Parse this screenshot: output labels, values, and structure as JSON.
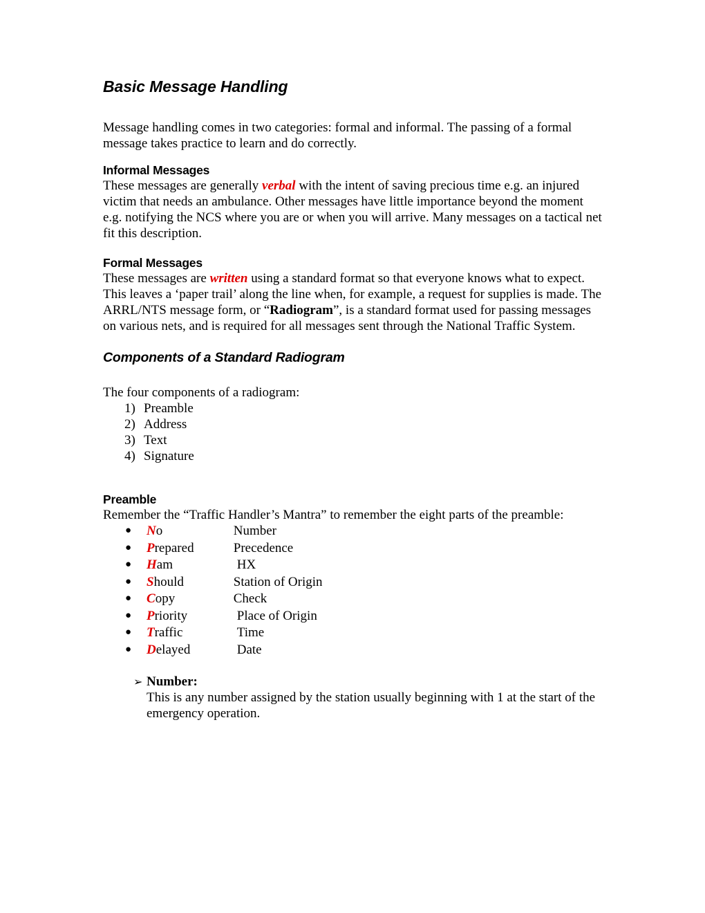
{
  "document": {
    "title": "Basic Message Handling",
    "intro": {
      "text": "Message handling comes in two categories: formal and informal.  The passing of a formal message takes practice to learn and do correctly."
    },
    "informal": {
      "heading": "Informal Messages",
      "part1": "These messages are generally ",
      "emphasis": "verbal",
      "part2": " with the intent of saving precious time e.g. an injured victim that needs an ambulance.  Other messages have little importance beyond the moment e.g. notifying the NCS where you are or when you will arrive. Many messages on a tactical net fit this description."
    },
    "formal": {
      "heading": "Formal Messages",
      "part1": "These messages are ",
      "emphasis": "written",
      "part2": " using a standard format so that everyone knows what to expect.  This leaves a ‘paper trail’ along the line when, for example, a request for supplies is made.  The ARRL/NTS message form, or “",
      "bold_term": "Radiogram",
      "part3": "”, is a standard format used for passing messages on various nets, and is required for all messages sent through the National Traffic System."
    },
    "components": {
      "heading": "Components of a Standard Radiogram",
      "lead_in": "The four components of a radiogram:",
      "items": [
        {
          "num": "1)",
          "label": "Preamble"
        },
        {
          "num": "2)",
          "label": "Address"
        },
        {
          "num": "3)",
          "label": "Text"
        },
        {
          "num": "4)",
          "label": "Signature"
        }
      ]
    },
    "preamble": {
      "heading": "Preamble",
      "lead_in": "Remember the “Traffic Handler’s Mantra” to remember the eight parts of the preamble:",
      "bullet_glyph": "●",
      "mnemonic": [
        {
          "initial": "N",
          "rest": "o",
          "meaning": "Number",
          "shift": false
        },
        {
          "initial": "P",
          "rest": "repared",
          "meaning": "Precedence",
          "shift": false
        },
        {
          "initial": "H",
          "rest": "am",
          "meaning": "HX",
          "shift": true
        },
        {
          "initial": "S",
          "rest": "hould",
          "meaning": "Station of Origin",
          "shift": false
        },
        {
          "initial": "C",
          "rest": "opy",
          "meaning": "Check",
          "shift": false
        },
        {
          "initial": "P",
          "rest": "riority",
          "meaning": "Place of Origin",
          "shift": true
        },
        {
          "initial": "T",
          "rest": "raffic",
          "meaning": "Time",
          "shift": true
        },
        {
          "initial": "D",
          "rest": "elayed",
          "meaning": "Date",
          "shift": true
        }
      ],
      "number_entry": {
        "arrow_glyph": "➢",
        "term": "Number:",
        "description": "This is any number assigned by the station usually beginning with 1 at the start of the emergency operation."
      }
    },
    "colors": {
      "emphasis_red": "#e00000",
      "text_black": "#000000",
      "page_background": "#ffffff"
    }
  }
}
